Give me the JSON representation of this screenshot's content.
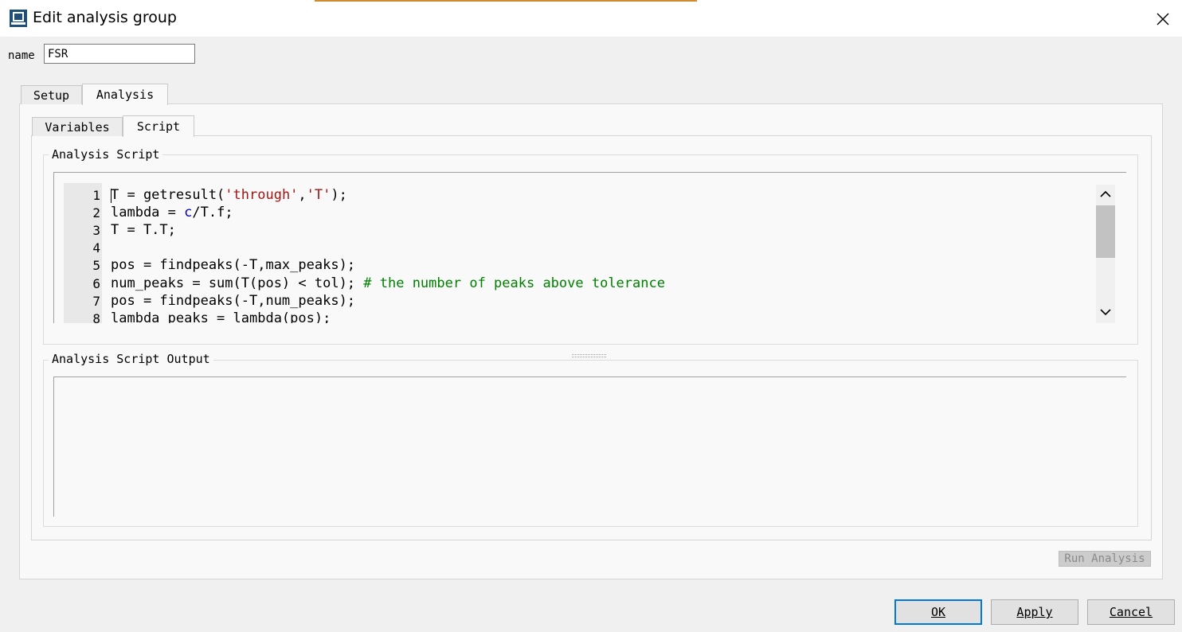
{
  "window": {
    "title": "Edit analysis group",
    "close_icon": "close-icon",
    "app_icon": "app-window-icon"
  },
  "name_field": {
    "label": "name",
    "value": "FSR"
  },
  "outer_tabs": [
    {
      "label": "Setup",
      "active": false
    },
    {
      "label": "Analysis",
      "active": true
    }
  ],
  "inner_tabs": [
    {
      "label": "Variables",
      "active": false
    },
    {
      "label": "Script",
      "active": true
    }
  ],
  "script_group": {
    "title": "Analysis Script",
    "line_numbers": [
      "1",
      "2",
      "3",
      "4",
      "5",
      "6",
      "7",
      "8"
    ],
    "lines": [
      [
        {
          "t": "T = getresult(",
          "c": "plain"
        },
        {
          "t": "'through'",
          "c": "str"
        },
        {
          "t": ",",
          "c": "plain"
        },
        {
          "t": "'T'",
          "c": "str"
        },
        {
          "t": ");",
          "c": "plain"
        }
      ],
      [
        {
          "t": "lambda = ",
          "c": "plain"
        },
        {
          "t": "c",
          "c": "var"
        },
        {
          "t": "/T.f;",
          "c": "plain"
        }
      ],
      [
        {
          "t": "T = T.T;",
          "c": "plain"
        }
      ],
      [],
      [
        {
          "t": "pos = findpeaks(-T,max_peaks);",
          "c": "plain"
        }
      ],
      [
        {
          "t": "num_peaks = sum(T(pos) < tol); ",
          "c": "plain"
        },
        {
          "t": "# the number of peaks above tolerance",
          "c": "cmt"
        }
      ],
      [
        {
          "t": "pos = findpeaks(-T,num_peaks);",
          "c": "plain"
        }
      ],
      [
        {
          "t": "lambda_peaks = lambda(pos);",
          "c": "plain"
        }
      ]
    ]
  },
  "output_group": {
    "title": "Analysis Script Output",
    "text": ""
  },
  "buttons": {
    "run": "Run Analysis",
    "ok": "OK",
    "apply": "Apply",
    "cancel": "Cancel"
  },
  "colors": {
    "string": "#a31515",
    "variable": "#0000c0",
    "comment": "#008000",
    "accent": "#0078d7"
  }
}
